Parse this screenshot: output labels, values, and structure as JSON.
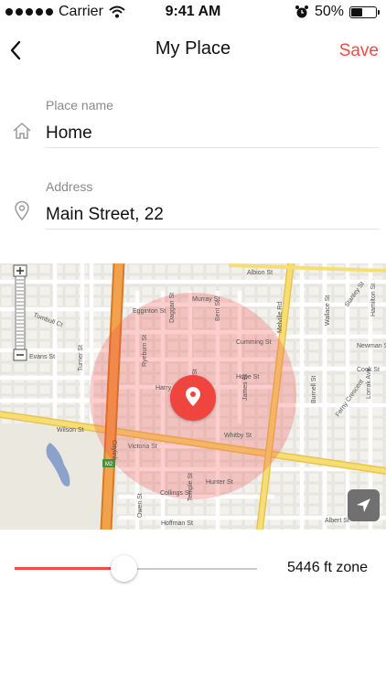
{
  "status_bar": {
    "carrier": "Carrier",
    "time": "9:41 AM",
    "battery": "50%",
    "battery_level": 0.5
  },
  "nav": {
    "title": "My Place",
    "save_label": "Save"
  },
  "place_name": {
    "label": "Place name",
    "value": "Home"
  },
  "address": {
    "label": "Address",
    "value": "Main Street, 22"
  },
  "map": {
    "street_labels": [
      "Albion St",
      "Murray St",
      "Egginton St",
      "Cumming St",
      "Bent St",
      "Hope St",
      "Harry St",
      "James St",
      "Whitby St",
      "Wilson St",
      "Victoria St",
      "Hunter St",
      "Collings St",
      "Temple St",
      "Hoffman St",
      "Owen St",
      "Albert St",
      "Melville Rd",
      "Burnell St",
      "Wallace St",
      "Turner St",
      "Evans St",
      "Tumbull Ct",
      "Ryeburn St",
      "Daggan St",
      "Dapeny St",
      "Newman St",
      "Cook St",
      "Hamilton St",
      "Lorrak Ave",
      "Ferny Crescent",
      "Stanley St",
      "Citylink"
    ],
    "highway_badge": "M2",
    "accent": "#f0443e"
  },
  "radius": {
    "zone_label": "5446 ft zone",
    "slider_fraction": 0.45,
    "accent": "#ef4b4b"
  },
  "icons": {
    "back": "chevron-left-icon",
    "home": "home-icon",
    "address": "location-pin-icon",
    "pin": "map-pin-icon",
    "locate": "navigation-arrow-icon"
  }
}
